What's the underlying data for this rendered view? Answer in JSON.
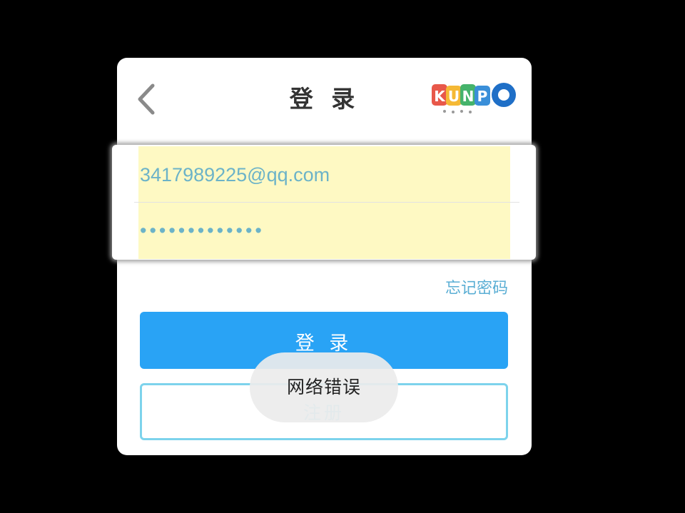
{
  "header": {
    "title": "登 录",
    "back_icon": "chevron-left-icon",
    "logo_text": "KUNPO"
  },
  "form": {
    "email_value": "3417989225@qq.com",
    "password_mask": "•••••••••••••",
    "forgot_password_label": "忘记密码"
  },
  "actions": {
    "login_label": "登 录",
    "register_label": "注册"
  },
  "toast": {
    "message": "网络错误"
  },
  "colors": {
    "primary": "#29a3f5",
    "register_border": "#7dd3ec",
    "autofill_bg": "#fef9c3",
    "link": "#5aaed4"
  }
}
